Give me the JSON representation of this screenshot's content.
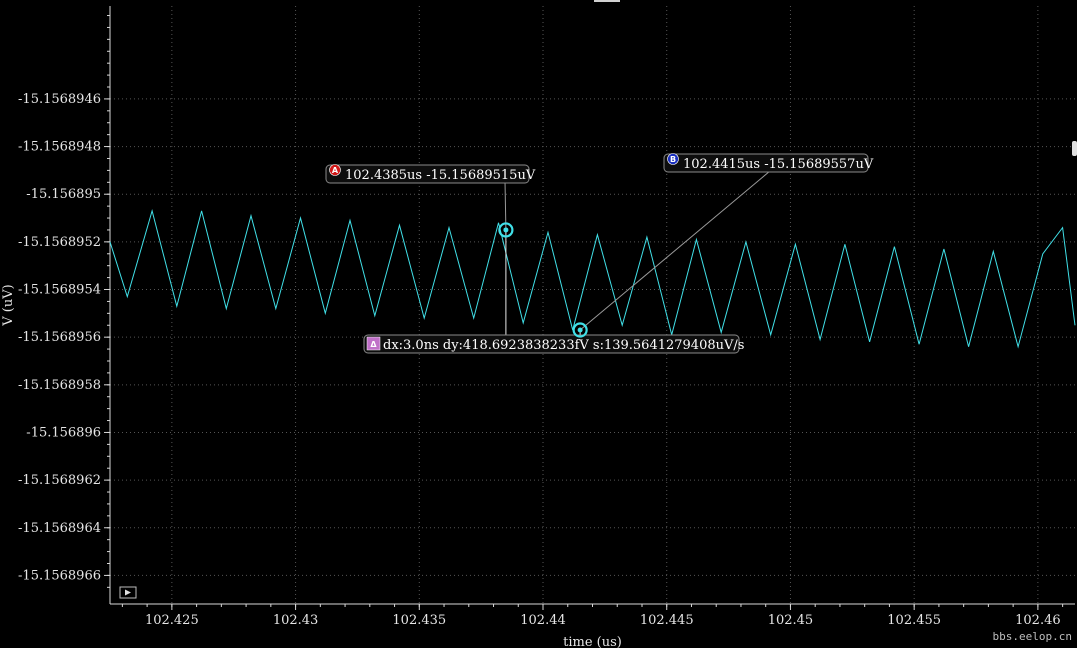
{
  "chart_data": {
    "type": "line",
    "xlabel": "time (us)",
    "ylabel": "V (uV)",
    "xlim": [
      102.4225,
      102.4615
    ],
    "ylim": [
      -15.15689672,
      -15.15689421
    ],
    "grid": true,
    "x_ticks": [
      102.425,
      102.43,
      102.435,
      102.44,
      102.445,
      102.45,
      102.455,
      102.46
    ],
    "x_tick_labels": [
      "102.425",
      "102.43",
      "102.435",
      "102.44",
      "102.445",
      "102.45",
      "102.455",
      "102.46"
    ],
    "y_ticks": [
      -15.1568946,
      -15.1568948,
      -15.156895,
      -15.1568952,
      -15.1568954,
      -15.1568956,
      -15.1568958,
      -15.156896,
      -15.1568962,
      -15.1568964,
      -15.1568966
    ],
    "y_tick_labels": [
      "-15.1568946",
      "-15.1568948",
      "-15.156895",
      "-15.1568952",
      "-15.1568954",
      "-15.1568956",
      "-15.1568958",
      "-15.156896",
      "-15.1568962",
      "-15.1568964",
      "-15.1568966"
    ],
    "series": [
      {
        "color": "#40e0e8",
        "x": [
          102.4225,
          102.4232,
          102.4242,
          102.4252,
          102.4262,
          102.4272,
          102.4282,
          102.4292,
          102.4302,
          102.4312,
          102.4322,
          102.4332,
          102.4342,
          102.4352,
          102.4362,
          102.4372,
          102.4382,
          102.4392,
          102.4402,
          102.4412,
          102.4422,
          102.4432,
          102.4442,
          102.4452,
          102.4462,
          102.4472,
          102.4482,
          102.4492,
          102.4502,
          102.4512,
          102.4522,
          102.4532,
          102.4542,
          102.4552,
          102.4562,
          102.4572,
          102.4582,
          102.4592,
          102.4602,
          102.461,
          102.4615
        ],
        "y": [
          -15.1568952,
          -15.15689543,
          -15.15689507,
          -15.15689547,
          -15.15689507,
          -15.15689548,
          -15.15689509,
          -15.15689548,
          -15.1568951,
          -15.1568955,
          -15.15689511,
          -15.15689551,
          -15.15689513,
          -15.15689552,
          -15.15689514,
          -15.15689552,
          -15.15689512,
          -15.15689554,
          -15.15689516,
          -15.15689557,
          -15.15689517,
          -15.15689555,
          -15.15689518,
          -15.15689559,
          -15.15689519,
          -15.15689558,
          -15.1568952,
          -15.15689559,
          -15.15689521,
          -15.15689561,
          -15.15689521,
          -15.15689562,
          -15.15689522,
          -15.15689563,
          -15.15689523,
          -15.15689564,
          -15.15689524,
          -15.15689564,
          -15.15689525,
          -15.15689514,
          -15.15689555
        ]
      }
    ],
    "markers": [
      {
        "id": "A",
        "x": 102.4385,
        "y": -15.15689515,
        "label": "102.4385us -15.15689515uV",
        "color": "#d01818"
      },
      {
        "id": "B",
        "x": 102.4415,
        "y": -15.15689557,
        "label": "102.4415us -15.15689557uV",
        "color": "#1a2fbf"
      }
    ],
    "delta": {
      "symbol": "Δ",
      "label": "dx:3.0ns dy:418.6923838233fV s:139.5641279408uV/s",
      "color": "#c070c8"
    }
  },
  "watermark": "bbs.eelop.cn",
  "play_icon": "play-icon"
}
